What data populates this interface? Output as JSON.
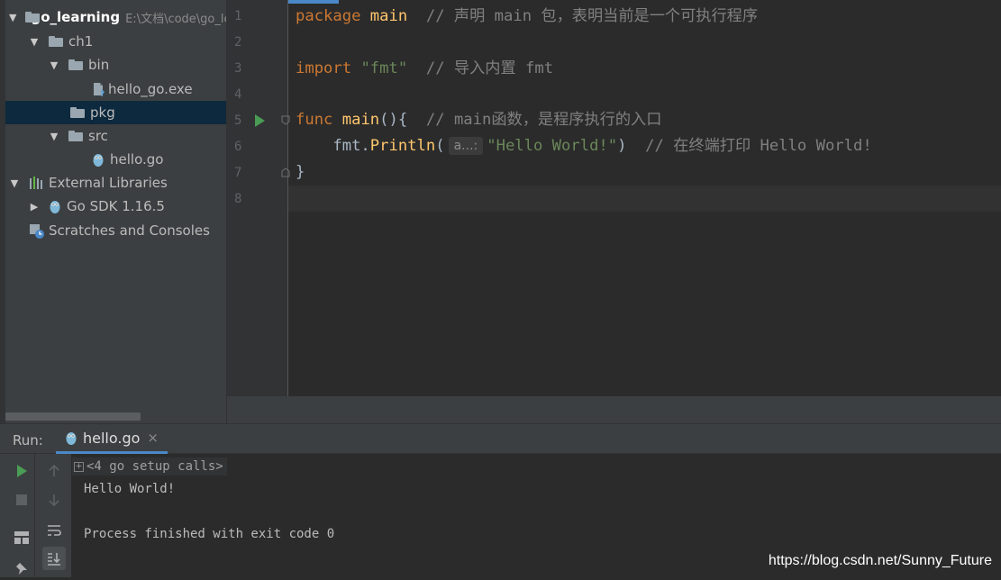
{
  "project": {
    "name": "go_learning",
    "path": "E:\\文档\\code\\go_learning",
    "tree": [
      {
        "label": "ch1"
      },
      {
        "label": "bin"
      },
      {
        "label": "hello_go.exe"
      },
      {
        "label": "pkg"
      },
      {
        "label": "src"
      },
      {
        "label": "hello.go"
      },
      {
        "label": "External Libraries"
      },
      {
        "label": "Go SDK 1.16.5"
      },
      {
        "label": "Scratches and Consoles"
      }
    ]
  },
  "editor": {
    "line_numbers": [
      "1",
      "2",
      "3",
      "4",
      "5",
      "6",
      "7",
      "8"
    ],
    "code": {
      "l1_kw": "package",
      "l1_name": " main",
      "l1_comment": "  // 声明 main 包，表明当前是一个可执行程序",
      "l3_kw": "import",
      "l3_str": " \"fmt\"",
      "l3_comment": "  // 导入内置 fmt",
      "l5_kw": "func",
      "l5_fn": " main",
      "l5_rest": "(){",
      "l5_comment": "  // main函数，是程序执行的入口",
      "l6_pkg": "    fmt.",
      "l6_fn": "Println",
      "l6_open": "(",
      "l6_hint": "a...:",
      "l6_str": "\"Hello World!\"",
      "l6_close": ")",
      "l6_comment": "  // 在终端打印 Hello World!",
      "l7": "}"
    }
  },
  "run": {
    "label": "Run:",
    "tab_name": "hello.go",
    "tab_close": "×",
    "console": {
      "setup_calls": "<4 go setup calls>",
      "output": "Hello World!",
      "exit_message": "Process finished with exit code 0"
    }
  },
  "watermark": "https://blog.csdn.net/Sunny_Future",
  "colors": {
    "background": "#2b2b2b",
    "panel": "#3c3f41",
    "keyword": "#cc7832",
    "function": "#ffc66d",
    "string": "#6a8759",
    "comment": "#808080",
    "run_green": "#499c54",
    "accent": "#4a88c7"
  }
}
